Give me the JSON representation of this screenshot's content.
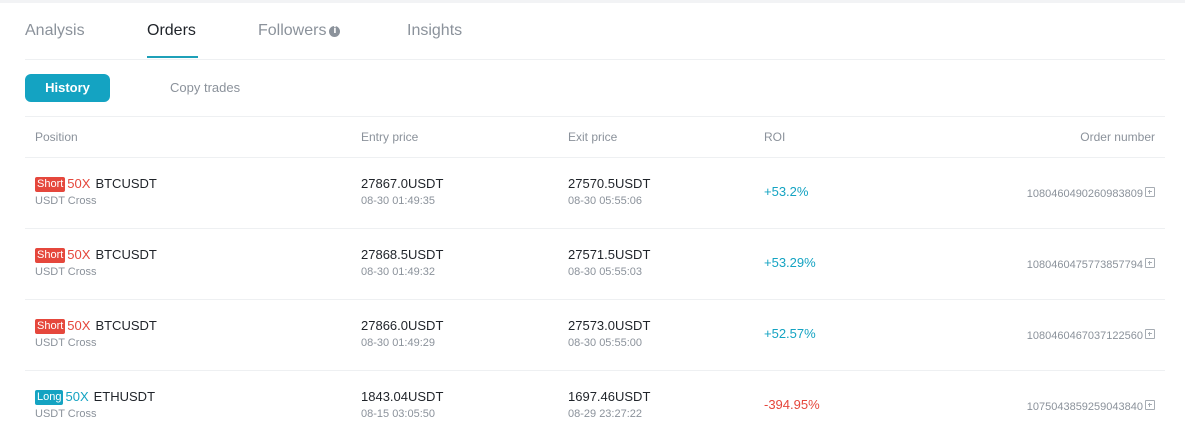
{
  "tabs": [
    {
      "label": "Analysis"
    },
    {
      "label": "Orders"
    },
    {
      "label": "Followers"
    },
    {
      "label": "Insights"
    }
  ],
  "active_tab": "Orders",
  "subtabs": {
    "history": "History",
    "copy_trades": "Copy trades"
  },
  "columns": {
    "position": "Position",
    "entry": "Entry price",
    "exit": "Exit price",
    "roi": "ROI",
    "order": "Order number"
  },
  "rows": [
    {
      "side": "Short",
      "leverage": "50X",
      "symbol": "BTCUSDT",
      "margin": "USDT Cross",
      "entry_price": "27867.0USDT",
      "entry_time": "08-30 01:49:35",
      "exit_price": "27570.5USDT",
      "exit_time": "08-30 05:55:06",
      "roi": "+53.2%",
      "order_number": "1080460490260983809"
    },
    {
      "side": "Short",
      "leverage": "50X",
      "symbol": "BTCUSDT",
      "margin": "USDT Cross",
      "entry_price": "27868.5USDT",
      "entry_time": "08-30 01:49:32",
      "exit_price": "27571.5USDT",
      "exit_time": "08-30 05:55:03",
      "roi": "+53.29%",
      "order_number": "1080460475773857794"
    },
    {
      "side": "Short",
      "leverage": "50X",
      "symbol": "BTCUSDT",
      "margin": "USDT Cross",
      "entry_price": "27866.0USDT",
      "entry_time": "08-30 01:49:29",
      "exit_price": "27573.0USDT",
      "exit_time": "08-30 05:55:00",
      "roi": "+52.57%",
      "order_number": "1080460467037122560"
    },
    {
      "side": "Long",
      "leverage": "50X",
      "symbol": "ETHUSDT",
      "margin": "USDT Cross",
      "entry_price": "1843.04USDT",
      "entry_time": "08-15 03:05:50",
      "exit_price": "1697.46USDT",
      "exit_time": "08-29 23:27:22",
      "roi": "-394.95%",
      "order_number": "1075043859259043840"
    }
  ],
  "colors": {
    "accent": "#14a3c2",
    "short": "#e5473c",
    "long": "#14a3c2",
    "negative": "#e5473c",
    "muted_text": "#8b929b",
    "primary_text": "#1f2329"
  }
}
